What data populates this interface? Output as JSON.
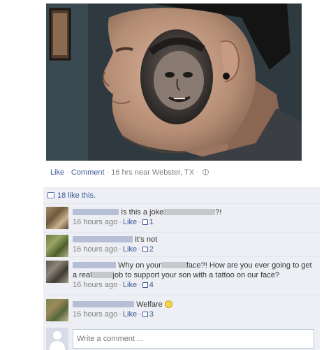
{
  "post": {
    "photo_alt": "Man with a tattoo of a baby's face on his cheek",
    "like_label": "Like",
    "comment_label": "Comment",
    "timestamp": "16 hrs near Webster, TX"
  },
  "likes": {
    "text": "18 like this."
  },
  "comments": [
    {
      "text_a": "Is this a joke",
      "text_b": "?!",
      "time": "16 hours ago",
      "like_label": "Like",
      "like_count": "1"
    },
    {
      "text": "It's not",
      "time": "16 hours ago",
      "like_label": "Like",
      "like_count": "2"
    },
    {
      "text_a": "Why on your",
      "text_b": "face?! How are you ever going to get",
      "text_c": "a real",
      "text_d": "job to support your son with a tattoo on our face?",
      "time": "16 hours ago",
      "like_label": "Like",
      "like_count": "4"
    },
    {
      "text": "Welfare",
      "time": "16 hours ago",
      "like_label": "Like",
      "like_count": "3"
    }
  ],
  "composer": {
    "placeholder": "Write a comment ..."
  },
  "colors": {
    "link": "#3b5998",
    "feedback_bg": "#edeff4",
    "meta": "#7f7f7f"
  }
}
